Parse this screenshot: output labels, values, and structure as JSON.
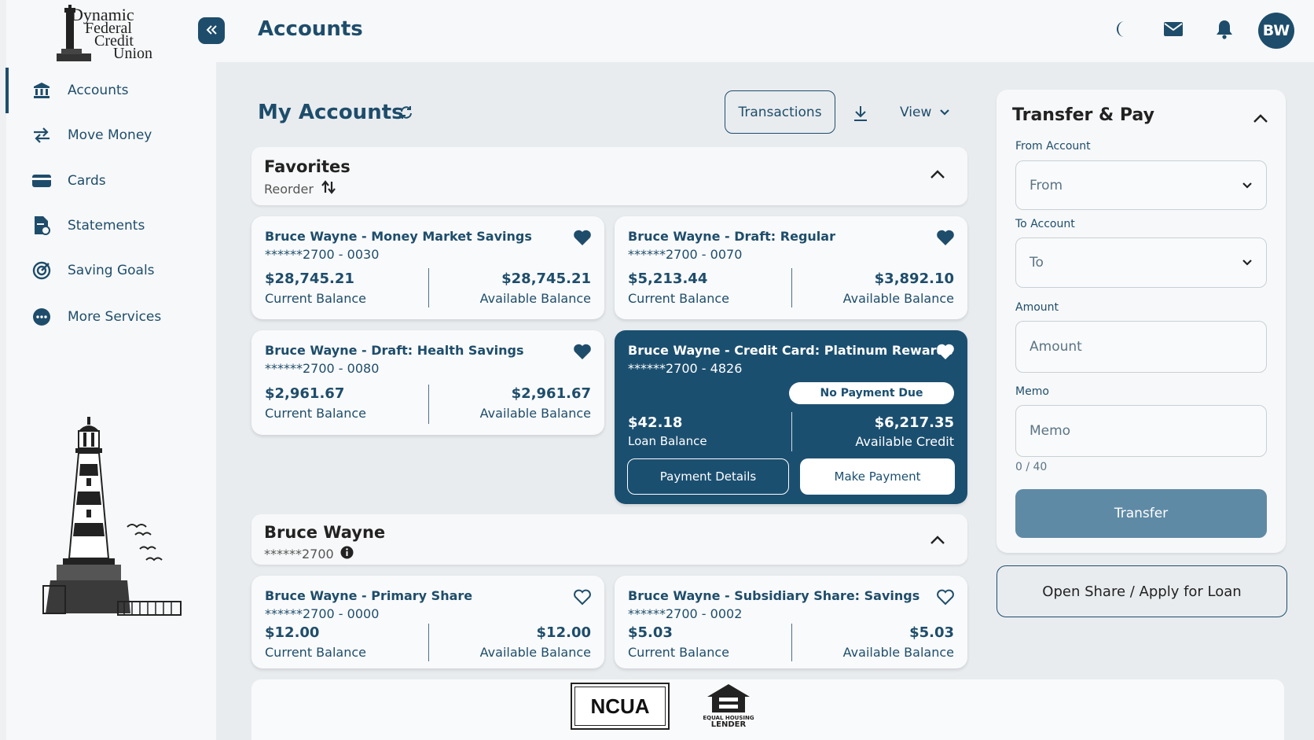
{
  "logo": {
    "line1": "Dynamic",
    "line2": "Federal",
    "line3": "Credit",
    "line4": "Union"
  },
  "header": {
    "title": "Accounts",
    "avatar_initials": "BW"
  },
  "sidebar": {
    "items": [
      {
        "label": "Accounts",
        "icon": "bank-icon",
        "active": true
      },
      {
        "label": "Move Money",
        "icon": "transfer-arrows-icon"
      },
      {
        "label": "Cards",
        "icon": "credit-card-icon"
      },
      {
        "label": "Statements",
        "icon": "statement-document-icon"
      },
      {
        "label": "Saving Goals",
        "icon": "target-icon"
      },
      {
        "label": "More Services",
        "icon": "more-dots-icon"
      }
    ]
  },
  "my_accounts": {
    "title": "My Accounts",
    "transactions_label": "Transactions",
    "view_label": "View"
  },
  "favorites": {
    "title": "Favorites",
    "reorder_label": "Reorder",
    "cards": [
      {
        "name": "Bruce Wayne - Money Market Savings",
        "number": "******2700 - 0030",
        "value1": "$28,745.21",
        "label1": "Current Balance",
        "value2": "$28,745.21",
        "label2": "Available Balance"
      },
      {
        "name": "Bruce Wayne - Draft: Regular",
        "number": "******2700 - 0070",
        "value1": "$5,213.44",
        "label1": "Current Balance",
        "value2": "$3,892.10",
        "label2": "Available Balance"
      },
      {
        "name": "Bruce Wayne - Draft: Health Savings",
        "number": "******2700 - 0080",
        "value1": "$2,961.67",
        "label1": "Current Balance",
        "value2": "$2,961.67",
        "label2": "Available Balance"
      },
      {
        "name": "Bruce Wayne - Credit Card: Platinum Rewards",
        "number": "******2700 - 4826",
        "badge": "No Payment Due",
        "value1": "$42.18",
        "label1": "Loan Balance",
        "value2": "$6,217.35",
        "label2": "Available Credit",
        "btn1": "Payment Details",
        "btn2": "Make Payment"
      }
    ]
  },
  "member": {
    "title": "Bruce Wayne",
    "number": "******2700",
    "cards": [
      {
        "name": "Bruce Wayne - Primary Share",
        "number": "******2700 - 0000",
        "value1": "$12.00",
        "label1": "Current Balance",
        "value2": "$12.00",
        "label2": "Available Balance"
      },
      {
        "name": "Bruce Wayne - Subsidiary Share: Savings",
        "number": "******2700 - 0002",
        "value1": "$5.03",
        "label1": "Current Balance",
        "value2": "$5.03",
        "label2": "Available Balance"
      }
    ]
  },
  "transfer": {
    "title": "Transfer & Pay",
    "from_label": "From Account",
    "from_placeholder": "From",
    "to_label": "To Account",
    "to_placeholder": "To",
    "amount_label": "Amount",
    "amount_placeholder": "Amount",
    "memo_label": "Memo",
    "memo_placeholder": "Memo",
    "memo_counter": "0 / 40",
    "submit_label": "Transfer"
  },
  "open_share_label": "Open Share / Apply for Loan",
  "footer": {
    "ncua": "NCUA",
    "ehl_line1": "EQUAL HOUSING",
    "ehl_line2": "LENDER"
  },
  "colors": {
    "primary": "#1e4d6b",
    "card_dark": "#1b4f70",
    "transfer_button": "#5f8aa5",
    "background": "#e9ecef"
  }
}
